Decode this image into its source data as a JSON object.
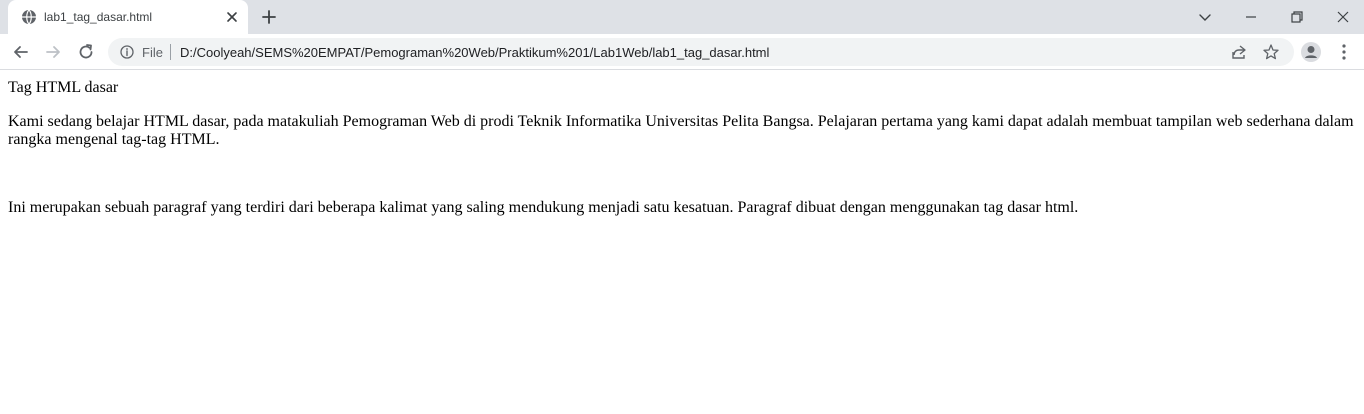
{
  "tab": {
    "title": "lab1_tag_dasar.html"
  },
  "toolbar": {
    "scheme_label": "File",
    "url": "D:/Coolyeah/SEMS%20EMPAT/Pemograman%20Web/Praktikum%201/Lab1Web/lab1_tag_dasar.html"
  },
  "icons": {
    "favicon": "globe-icon",
    "tab_close": "close-icon",
    "new_tab": "plus-icon",
    "back": "arrow-left-icon",
    "forward": "arrow-right-icon",
    "reload": "reload-icon",
    "site_info": "info-icon",
    "share": "share-icon",
    "bookmark": "star-icon",
    "profile": "person-icon",
    "menu": "kebab-menu-icon"
  },
  "page": {
    "heading_text": "Tag HTML dasar",
    "intro_paragraph": "Kami sedang belajar HTML dasar, pada matakuliah Pemograman Web di prodi Teknik Informatika Universitas Pelita Bangsa. Pelajaran pertama yang kami dapat adalah membuat tampilan web sederhana dalam rangka mengenal tag-tag HTML.",
    "second_paragraph": "Ini merupakan sebuah paragraf yang terdiri dari beberapa kalimat yang saling mendukung menjadi satu kesatuan. Paragraf dibuat dengan menggunakan tag dasar html."
  },
  "colors": {
    "tabstrip_bg": "#dee1e6",
    "omnibox_bg": "#f1f3f4",
    "icon_gray": "#5f6368",
    "page_text": "#000000"
  }
}
